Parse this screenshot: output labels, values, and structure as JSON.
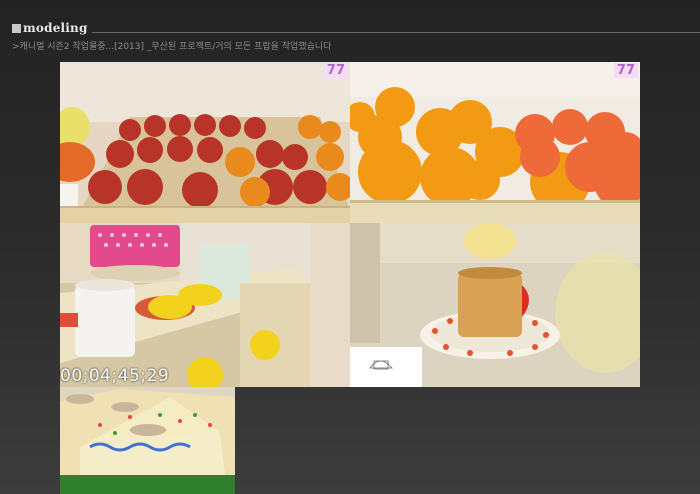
{
  "header": {
    "title": "modeling",
    "subtitle": ">캐니멀 시즌2 작업물중...[2013] _무산된 프로젝트/거의 모든 프랍을 작업했습니다"
  },
  "gallery": {
    "badge_text": "77",
    "timecode": "00;04;45;29",
    "badge_color": "#f3dcf6"
  }
}
